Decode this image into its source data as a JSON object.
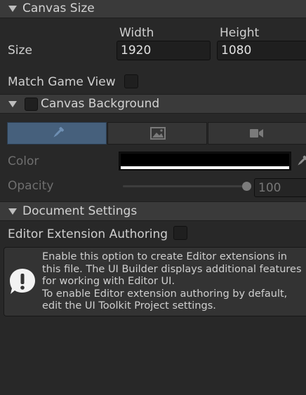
{
  "canvas_size": {
    "header": "Canvas Size",
    "size_label": "Size",
    "width_label": "Width",
    "height_label": "Height",
    "width_value": "1920",
    "height_value": "1080",
    "match_game_view_label": "Match Game View",
    "match_game_view_checked": false
  },
  "canvas_background": {
    "header": "Canvas Background",
    "enabled": false,
    "tabs": [
      {
        "icon": "eyedropper-icon",
        "active": true
      },
      {
        "icon": "image-icon",
        "active": false
      },
      {
        "icon": "camera-icon",
        "active": false
      }
    ],
    "color_label": "Color",
    "color_value": "#000000",
    "opacity_label": "Opacity",
    "opacity_value": "100",
    "opacity_fraction": 1.0
  },
  "document_settings": {
    "header": "Document Settings",
    "editor_ext_label": "Editor Extension Authoring",
    "editor_ext_checked": false,
    "help_lines": [
      "Enable this option to create Editor extensions in",
      "this file. The UI Builder displays additional features",
      "for working with Editor UI.",
      "To enable Editor extension authoring by default,",
      "edit the UI Toolkit Project settings."
    ]
  }
}
